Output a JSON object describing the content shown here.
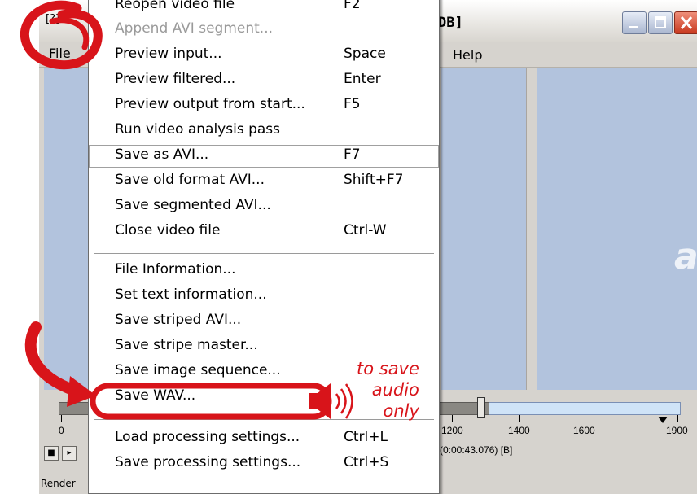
{
  "window": {
    "title_left": "[?] V",
    "title_right": "DB]",
    "menu": {
      "file_label": "File",
      "help_label": "Help"
    }
  },
  "file_menu": {
    "items": [
      {
        "label": "Reopen video file",
        "shortcut": "F2",
        "disabled": false
      },
      {
        "label": "Append AVI segment...",
        "shortcut": "",
        "disabled": true
      },
      {
        "label": "Preview input...",
        "shortcut": "Space",
        "disabled": false
      },
      {
        "label": "Preview filtered...",
        "shortcut": "Enter",
        "disabled": false
      },
      {
        "label": "Preview output from start...",
        "shortcut": "F5",
        "disabled": false
      },
      {
        "label": "Run video analysis pass",
        "shortcut": "",
        "disabled": false
      },
      {
        "label": "Save as AVI...",
        "shortcut": "F7",
        "disabled": false,
        "highlighted": true
      },
      {
        "label": "Save old format AVI...",
        "shortcut": "Shift+F7",
        "disabled": false
      },
      {
        "label": "Save segmented AVI...",
        "shortcut": "",
        "disabled": false
      },
      {
        "label": "Close video file",
        "shortcut": "Ctrl-W",
        "disabled": false
      },
      {
        "label": "File Information...",
        "shortcut": "",
        "disabled": false
      },
      {
        "label": "Set text information...",
        "shortcut": "",
        "disabled": false
      },
      {
        "label": "Save striped AVI...",
        "shortcut": "",
        "disabled": false
      },
      {
        "label": "Save stripe master...",
        "shortcut": "",
        "disabled": false
      },
      {
        "label": "Save image sequence...",
        "shortcut": "",
        "disabled": false
      },
      {
        "label": "Save WAV...",
        "shortcut": "",
        "disabled": false,
        "annotated": true
      },
      {
        "label": "Load processing settings...",
        "shortcut": "Ctrl+L",
        "disabled": false
      },
      {
        "label": "Save processing settings...",
        "shortcut": "Ctrl+S",
        "disabled": false
      }
    ]
  },
  "timeline": {
    "tick_labels": [
      "0",
      "1200",
      "1400",
      "1600",
      "1900"
    ],
    "frame_status": "(0:00:43.076) [B]"
  },
  "status_bar": {
    "render_label": "Render"
  },
  "annotation": {
    "lines": [
      "to save",
      "audio",
      "only"
    ],
    "icon": "speaker-icon",
    "color": "#d8141a"
  }
}
